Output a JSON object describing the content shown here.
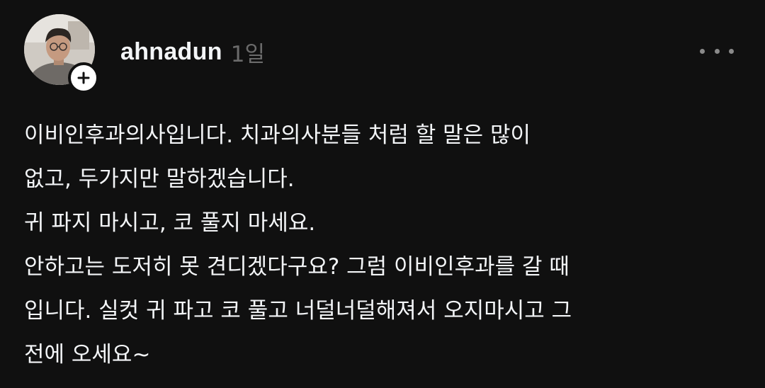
{
  "post": {
    "author": {
      "username": "ahnadun",
      "timestamp": "1일"
    },
    "icons": {
      "avatar": "profile-photo",
      "follow": "plus-icon",
      "more": "more-dots-icon"
    },
    "lines": [
      "이비인후과의사입니다. 치과의사분들 처럼 할 말은 많이",
      "없고, 두가지만 말하겠습니다.",
      "귀 파지 마시고, 코 풀지 마세요.",
      "안하고는 도저히 못 견디겠다구요? 그럼 이비인후과를 갈 때",
      "입니다. 실컷 귀 파고 코 풀고 너덜너덜해져서 오지마시고 그",
      "전에 오세요~"
    ]
  },
  "colors": {
    "background": "#101010",
    "text": "#f3f5f7",
    "muted": "#6b6b6b",
    "badge": "#ffffff"
  }
}
